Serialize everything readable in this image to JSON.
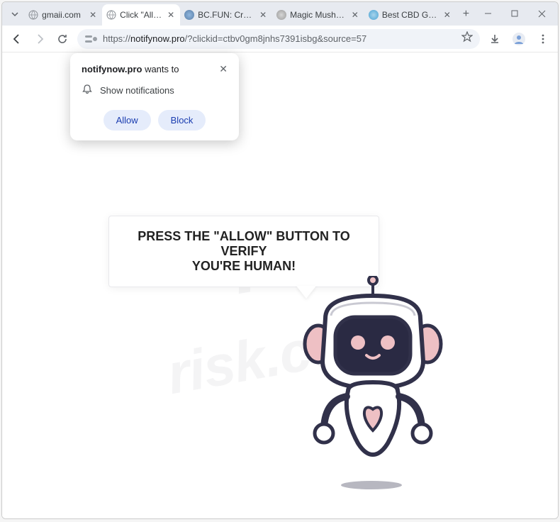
{
  "tabs": [
    {
      "title": "gmaii.com",
      "active": false,
      "icon": "globe"
    },
    {
      "title": "Click \"Allow\"",
      "active": true,
      "icon": "globe"
    },
    {
      "title": "BC.FUN: Crypto…",
      "active": false,
      "icon": "site"
    },
    {
      "title": "Magic Mushroo…",
      "active": false,
      "icon": "site"
    },
    {
      "title": "Best CBD Gumn…",
      "active": false,
      "icon": "site"
    }
  ],
  "address": {
    "scheme": "https://",
    "host": "notifynow.pro",
    "path": "/?clickid=ctbv0gm8jnhs7391isbg&source=57"
  },
  "prompt": {
    "site": "notifynow.pro",
    "wants": " wants to",
    "body": "Show notifications",
    "allow": "Allow",
    "block": "Block"
  },
  "content": {
    "line1": "PRESS THE \"ALLOW\" BUTTON TO VERIFY",
    "line2": "YOU'RE HUMAN!"
  },
  "watermark": {
    "brand": "pc",
    "sub": "risk.com"
  },
  "colors": {
    "ink": "#31314a",
    "pink": "#eec0c4",
    "face": "#2a2a43"
  }
}
